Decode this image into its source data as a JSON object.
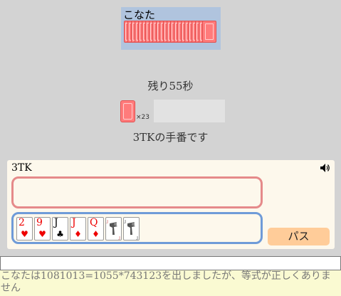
{
  "opponent": {
    "name": "こなた",
    "card_back_count": 23
  },
  "timer": {
    "text": "残り55秒"
  },
  "deck": {
    "count_label": "×23"
  },
  "turn": {
    "message": "3TKの手番です"
  },
  "player": {
    "name": "3TK",
    "hand": [
      {
        "rank": "2",
        "suit": "♥",
        "color": "red"
      },
      {
        "rank": "9",
        "suit": "♥",
        "color": "red"
      },
      {
        "rank": "J",
        "suit": "♣",
        "color": "black"
      },
      {
        "rank": "J",
        "suit": "♦",
        "color": "red"
      },
      {
        "rank": "Q",
        "suit": "♦",
        "color": "red"
      },
      {
        "rank": "JK",
        "suit": "",
        "color": "red"
      },
      {
        "rank": "JK",
        "suit": "",
        "color": "black"
      }
    ],
    "pass_label": "パス"
  },
  "chat": {
    "value": ""
  },
  "log": {
    "line": "こなたは1081013=1055*743123を出しましたが、等式が正しくありません"
  },
  "colors": {
    "background": "#d3d3d3",
    "opponent_box": "#b0c4de",
    "panel": "#fdf8ec",
    "submit_border": "#e58a8a",
    "hand_border": "#6f9bd8",
    "pass_button": "#ffcc99",
    "log_bg": "#fafad2"
  }
}
